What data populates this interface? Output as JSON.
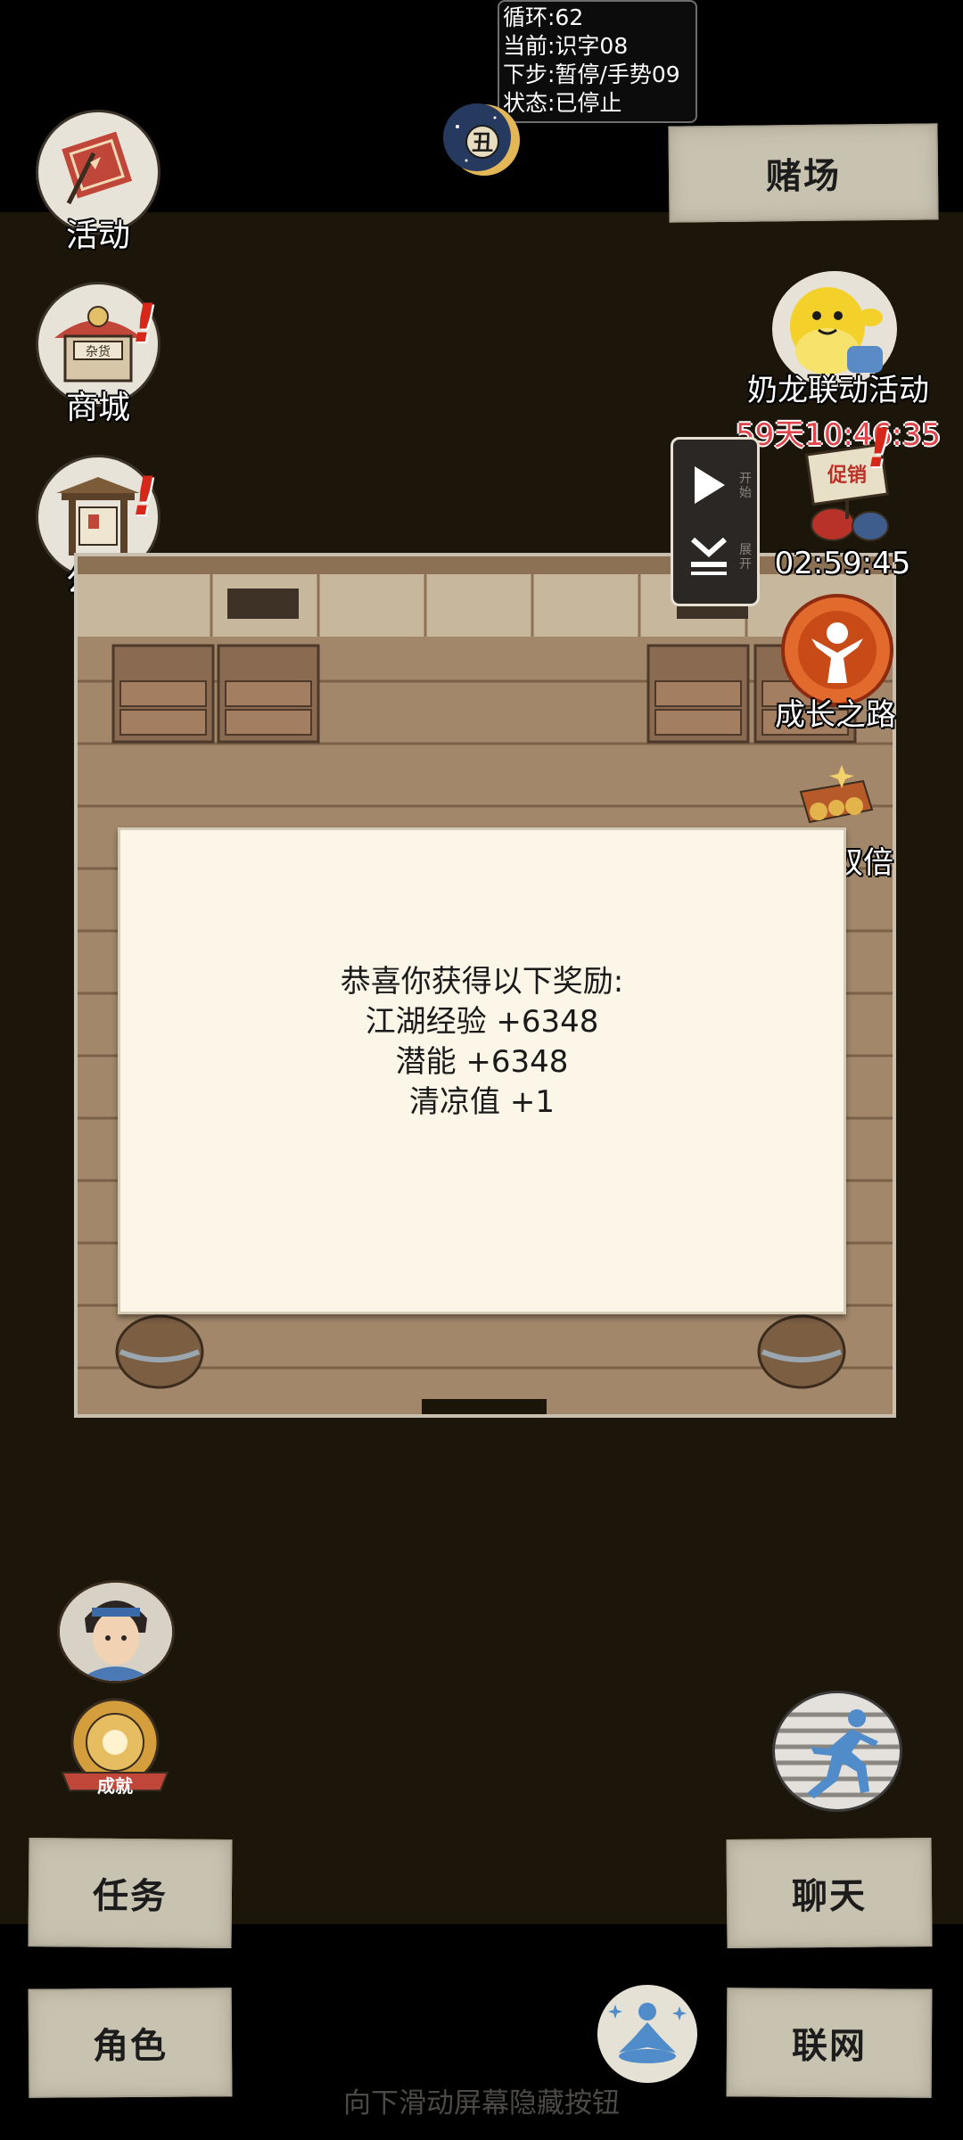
{
  "debug": {
    "loop": "循环:62",
    "current": "当前:识字08",
    "next": "下步:暂停/手势09",
    "status": "状态:已停止"
  },
  "time_badge": {
    "glyph": "丑"
  },
  "top_right": {
    "casino_label": "赌场"
  },
  "left_menu": [
    {
      "label": "活动",
      "icon": "flag-icon",
      "alert": false
    },
    {
      "label": "商城",
      "icon": "shop-icon",
      "alert": true,
      "sign_text": "杂货"
    },
    {
      "label": "公告",
      "icon": "notice-board-icon",
      "alert": true
    }
  ],
  "right_menu": {
    "collab": {
      "label": "奶龙联动活动",
      "timer": "59天10:46:35"
    },
    "promo": {
      "sign_text": "促销",
      "timer": "02:59:45"
    },
    "growth": {
      "label": "成长之路"
    },
    "double": {
      "label": "双倍"
    }
  },
  "float_controller": {
    "play_label": "开始",
    "expand_label": "展开"
  },
  "reward_dialog": {
    "line1": "恭喜你获得以下奖励:",
    "line2": "江湖经验 +6348",
    "line3": "潜能 +6348",
    "line4": "清凉值 +1"
  },
  "bottom_left": {
    "achievement_ribbon": "成就"
  },
  "buttons": {
    "task": "任务",
    "role": "角色",
    "chat": "聊天",
    "network": "联网"
  },
  "hint": "向下滑动屏幕隐藏按钮",
  "colors": {
    "play_area": "#1c1509",
    "paper": "#c8c2b1",
    "dialog": "#fcf6e8",
    "alert": "#d5281b",
    "timer_red": "#e0454c"
  }
}
